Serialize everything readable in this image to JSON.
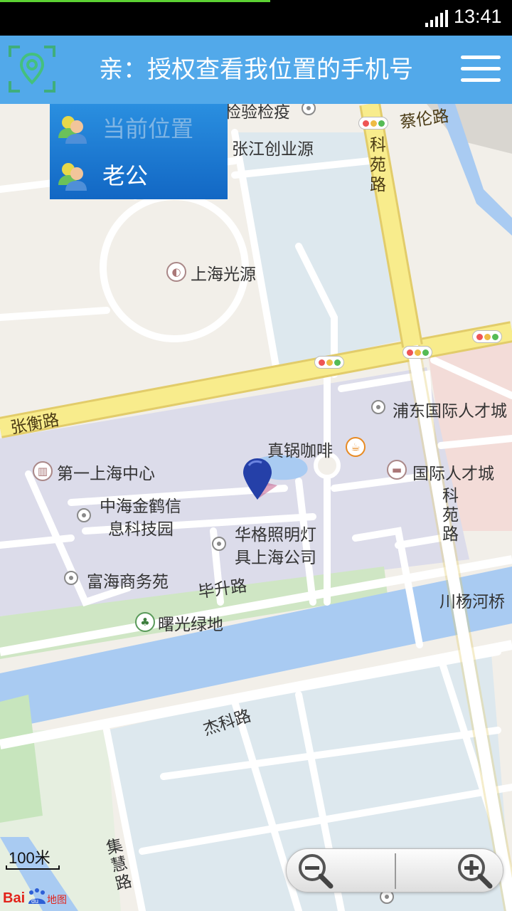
{
  "status_bar": {
    "time": "13:41"
  },
  "header": {
    "title": "亲：授权查看我位置的手机号"
  },
  "contacts": [
    {
      "label": "当前位置",
      "color": "#7fb5e4"
    },
    {
      "label": "老公",
      "color": "#ffffff"
    }
  ],
  "map": {
    "labels": {
      "checkpoint": "检验检疫",
      "zhangjiang": "张江创业源",
      "shguangyuan": "上海光源",
      "pudong_talent": "浦东国际人才城",
      "coffee": "真锅咖啡",
      "first_sh_center": "第一上海中心",
      "intl_talent_city": "国际人才城",
      "zhonghai": "中海金鹤信",
      "zhonghai_2": "息科技园",
      "huage": "华格照明灯",
      "huage_2": "具上海公司",
      "fuhai": "富海商务苑",
      "shuguang": "曙光绿地",
      "chuanyang": "川杨河桥"
    },
    "roads": {
      "cailun": "蔡伦路",
      "keyuan_top": "科苑路",
      "zhangheng": "张衡路",
      "keyuan_right": "科苑路",
      "bisheng": "毕升路",
      "jieke": "杰科路",
      "jihui": "集慧路"
    },
    "scale": "100米",
    "brand": "Baidu地图"
  },
  "icons": [
    "signal-icon",
    "location-pin-icon",
    "menu-icon",
    "contact-avatar-icon",
    "zoom-in-icon",
    "zoom-out-icon",
    "map-marker-icon"
  ],
  "colors": {
    "header": "#52a9ea",
    "dropdown": "#1a7ad2",
    "road_major": "#f8ec8c",
    "water": "#a9cbf2",
    "green": "#c7e5bd",
    "campus": "#dcdcea"
  }
}
